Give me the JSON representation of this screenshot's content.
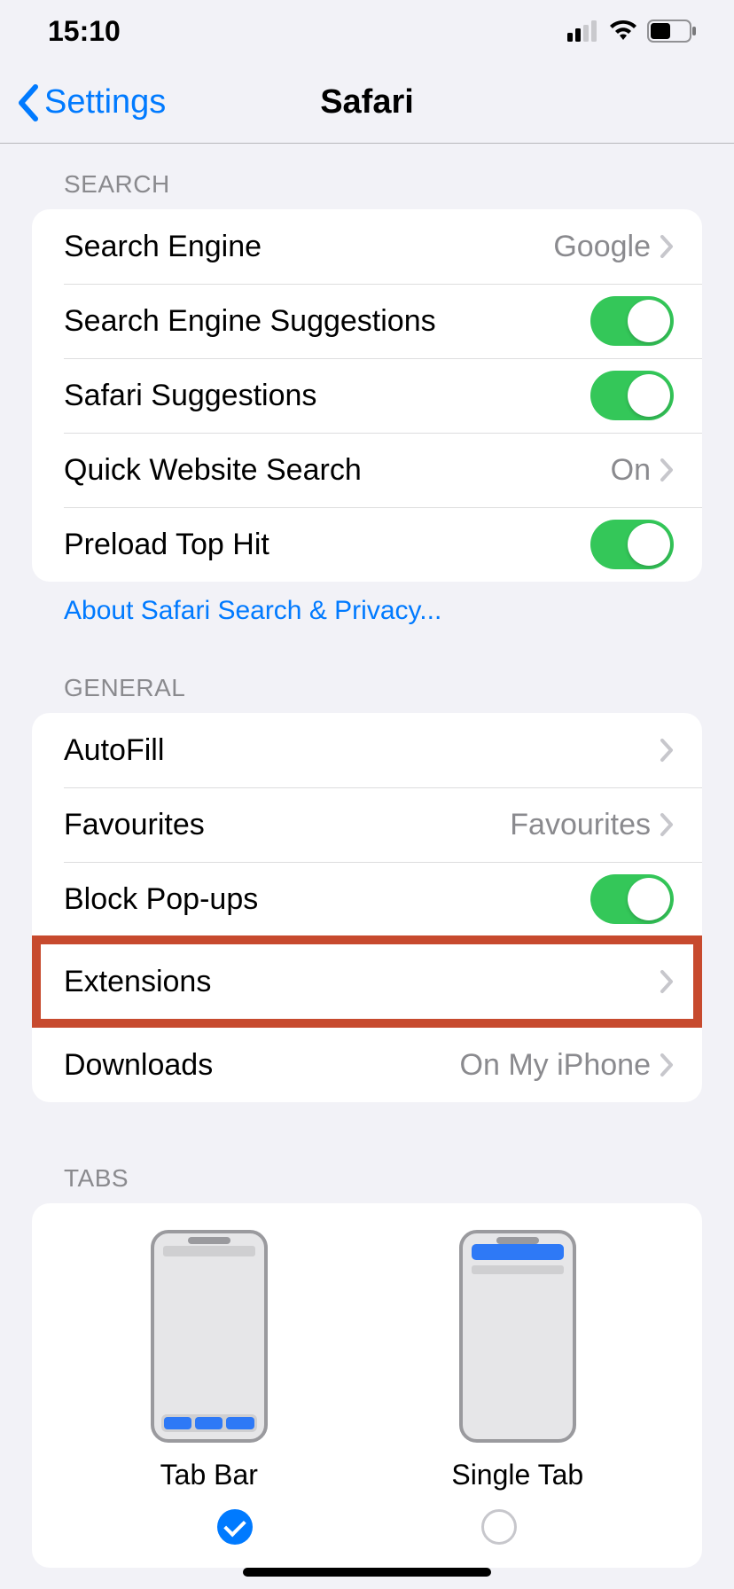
{
  "status": {
    "time": "15:10"
  },
  "nav": {
    "back_label": "Settings",
    "title": "Safari"
  },
  "sections": {
    "search": {
      "header": "SEARCH",
      "rows": {
        "search_engine": {
          "label": "Search Engine",
          "value": "Google"
        },
        "search_engine_suggestions": {
          "label": "Search Engine Suggestions",
          "on": true
        },
        "safari_suggestions": {
          "label": "Safari Suggestions",
          "on": true
        },
        "quick_website_search": {
          "label": "Quick Website Search",
          "value": "On"
        },
        "preload_top_hit": {
          "label": "Preload Top Hit",
          "on": true
        }
      },
      "footer": "About Safari Search & Privacy..."
    },
    "general": {
      "header": "GENERAL",
      "rows": {
        "autofill": {
          "label": "AutoFill"
        },
        "favourites": {
          "label": "Favourites",
          "value": "Favourites"
        },
        "block_popups": {
          "label": "Block Pop-ups",
          "on": true
        },
        "extensions": {
          "label": "Extensions"
        },
        "downloads": {
          "label": "Downloads",
          "value": "On My iPhone"
        }
      }
    },
    "tabs": {
      "header": "TABS",
      "options": {
        "tab_bar": {
          "label": "Tab Bar",
          "selected": true
        },
        "single_tab": {
          "label": "Single Tab",
          "selected": false
        }
      }
    }
  },
  "colors": {
    "accent": "#007aff",
    "toggle_on": "#34c759",
    "highlight_border": "#c74a2e"
  }
}
